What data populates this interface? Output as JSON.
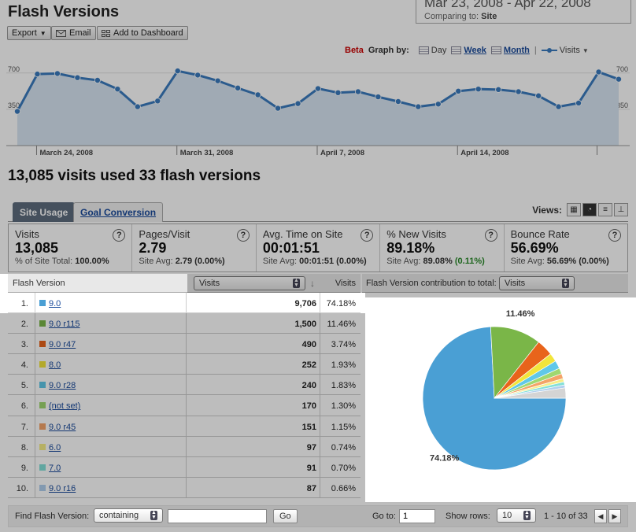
{
  "header": {
    "title": "Flash Versions",
    "export_label": "Export",
    "email_label": "Email",
    "dashboard_label": "Add to Dashboard",
    "date_range": "Mar 23, 2008 - Apr 22, 2008",
    "comparing_label": "Comparing to:",
    "comparing_value": "Site"
  },
  "graph_by": {
    "beta": "Beta",
    "label": "Graph by:",
    "day": "Day",
    "week": "Week",
    "month": "Month",
    "separator": "|",
    "legend": "Visits",
    "accent": "#3a7bbf"
  },
  "line_chart": {
    "y_ticks": [
      "700",
      "350"
    ],
    "x_labels": [
      "March 24, 2008",
      "March 31, 2008",
      "April 7, 2008",
      "April 14, 2008"
    ],
    "ylim": [
      0,
      850
    ],
    "values": [
      330,
      690,
      695,
      655,
      630,
      545,
      375,
      430,
      720,
      680,
      625,
      555,
      490,
      360,
      405,
      550,
      510,
      520,
      470,
      425,
      375,
      400,
      525,
      545,
      540,
      520,
      480,
      375,
      410,
      710,
      640
    ]
  },
  "summary": "13,085 visits used 33 flash versions",
  "tabs": {
    "site_usage": "Site Usage",
    "goal_conversion": "Goal Conversion",
    "views_label": "Views:"
  },
  "metrics": [
    {
      "name": "Visits",
      "value": "13,085",
      "sub_label": "% of Site Total:",
      "sub_value": "100.00%",
      "sub_extra": ""
    },
    {
      "name": "Pages/Visit",
      "value": "2.79",
      "sub_label": "Site Avg:",
      "sub_value": "2.79 (0.00%)",
      "sub_extra": ""
    },
    {
      "name": "Avg. Time on Site",
      "value": "00:01:51",
      "sub_label": "Site Avg:",
      "sub_value": "00:01:51 (0.00%)",
      "sub_extra": ""
    },
    {
      "name": "% New Visits",
      "value": "89.18%",
      "sub_label": "Site Avg:",
      "sub_value": "89.08%",
      "sub_extra": "(0.11%)"
    },
    {
      "name": "Bounce Rate",
      "value": "56.69%",
      "sub_label": "Site Avg:",
      "sub_value": "56.69% (0.00%)",
      "sub_extra": ""
    }
  ],
  "table": {
    "col_dimension": "Flash Version",
    "col_metric_select": "Visits",
    "col_visits": "Visits",
    "contribution_label": "Flash Version contribution to total:",
    "contribution_select": "Visits",
    "rows": [
      {
        "idx": "1.",
        "name": "9.0",
        "visits": "9,706",
        "pct": "74.18%",
        "color": "#4a9fd4"
      },
      {
        "idx": "2.",
        "name": "9.0 r115",
        "visits": "1,500",
        "pct": "11.46%",
        "color": "#7ab648"
      },
      {
        "idx": "3.",
        "name": "9.0 r47",
        "visits": "490",
        "pct": "3.74%",
        "color": "#e8641b"
      },
      {
        "idx": "4.",
        "name": "8.0",
        "visits": "252",
        "pct": "1.93%",
        "color": "#f2e53b"
      },
      {
        "idx": "5.",
        "name": "9.0 r28",
        "visits": "240",
        "pct": "1.83%",
        "color": "#60c8e8"
      },
      {
        "idx": "6.",
        "name": "(not set)",
        "visits": "170",
        "pct": "1.30%",
        "color": "#a0d870"
      },
      {
        "idx": "7.",
        "name": "9.0 r45",
        "visits": "151",
        "pct": "1.15%",
        "color": "#f4a468"
      },
      {
        "idx": "8.",
        "name": "6.0",
        "visits": "97",
        "pct": "0.74%",
        "color": "#f6ee88"
      },
      {
        "idx": "9.",
        "name": "7.0",
        "visits": "91",
        "pct": "0.70%",
        "color": "#84e0d8"
      },
      {
        "idx": "10.",
        "name": "9.0 r16",
        "visits": "87",
        "pct": "0.66%",
        "color": "#b0cfee"
      }
    ],
    "other_color": "#d4d4d4"
  },
  "chart_data": {
    "type": "pie",
    "labels": [
      "9.0",
      "9.0 r115",
      "9.0 r47",
      "8.0",
      "9.0 r28",
      "(not set)",
      "9.0 r45",
      "6.0",
      "7.0",
      "9.0 r16",
      "Other"
    ],
    "values": [
      74.18,
      11.46,
      3.74,
      1.93,
      1.83,
      1.3,
      1.15,
      0.74,
      0.7,
      0.66,
      2.31
    ],
    "data_labels": [
      "74.18%",
      "11.46%"
    ]
  },
  "footer": {
    "find_label": "Find Flash Version:",
    "containing": "containing",
    "go_label": "Go",
    "goto_label": "Go to:",
    "goto_value": "1",
    "show_rows_label": "Show rows:",
    "show_rows_value": "10",
    "pagination": "1 - 10 of 33"
  }
}
